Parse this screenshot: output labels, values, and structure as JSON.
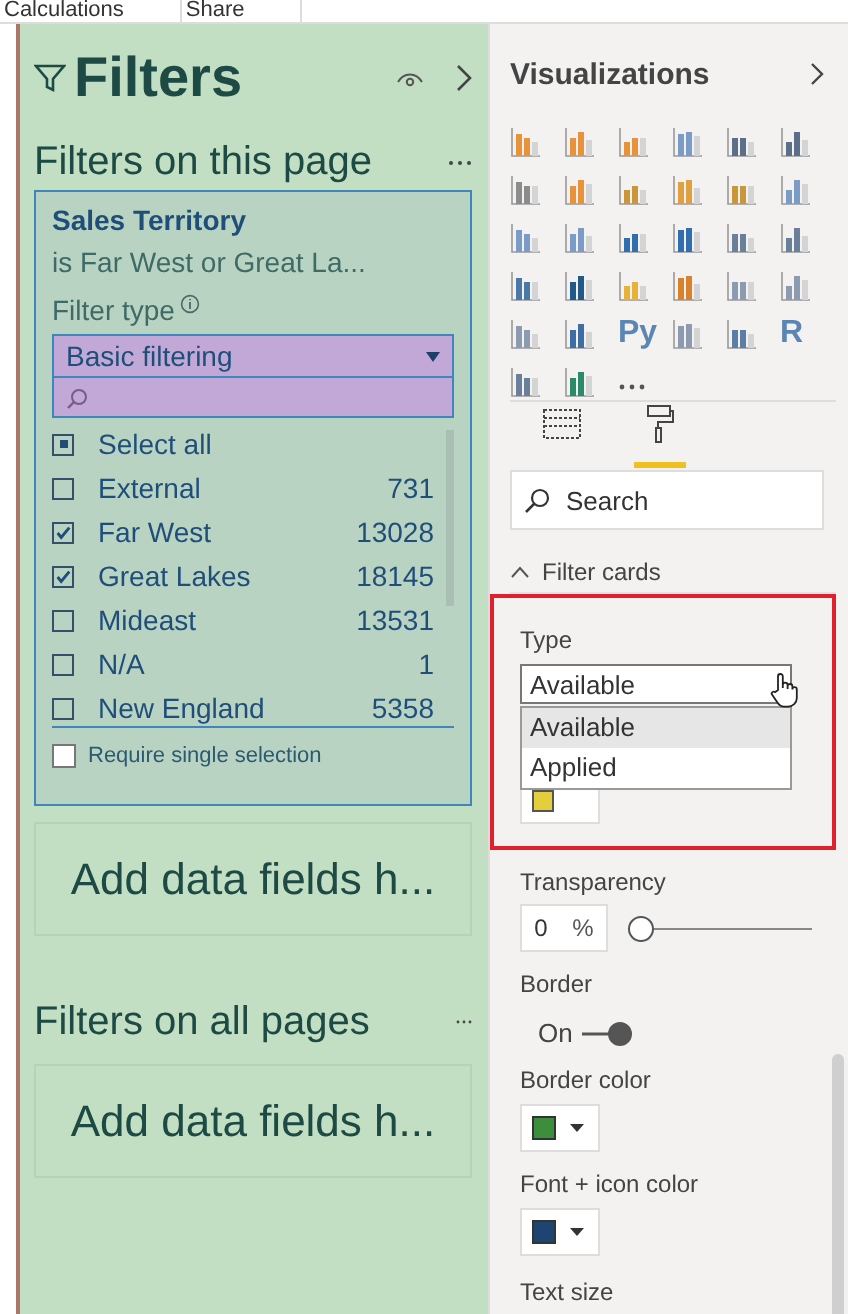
{
  "top_bar": {
    "tabs": [
      "Calculations",
      "Share"
    ]
  },
  "filters_pane": {
    "title": "Filters",
    "section_page": "Filters on this page",
    "card": {
      "title": "Sales Territory",
      "summary": "is Far West or Great La...",
      "filter_type_label": "Filter type",
      "filter_type_value": "Basic filtering",
      "items": [
        {
          "label": "Select all",
          "checked": false,
          "partial": true
        },
        {
          "label": "External",
          "count": "731",
          "checked": false,
          "partial": false
        },
        {
          "label": "Far West",
          "count": "13028",
          "checked": true,
          "partial": false
        },
        {
          "label": "Great Lakes",
          "count": "18145",
          "checked": true,
          "partial": false
        },
        {
          "label": "Mideast",
          "count": "13531",
          "checked": false,
          "partial": false
        },
        {
          "label": "N/A",
          "count": "1",
          "checked": false,
          "partial": false
        },
        {
          "label": "New England",
          "count": "5358",
          "checked": false,
          "partial": false
        }
      ],
      "require_single": {
        "label": "Require single selection",
        "checked": false
      }
    },
    "add_page": "Add data fields h...",
    "section_all": "Filters on all pages",
    "add_all": "Add data fields h..."
  },
  "viz_pane": {
    "title": "Visualizations",
    "icons": [
      {
        "kind": "icon",
        "color": "#e8923a"
      },
      {
        "kind": "icon",
        "color": "#e8923a"
      },
      {
        "kind": "icon",
        "color": "#e8923a"
      },
      {
        "kind": "icon",
        "color": "#7a9cc6"
      },
      {
        "kind": "icon",
        "color": "#5b6e8a"
      },
      {
        "kind": "icon",
        "color": "#5b6e8a"
      },
      {
        "kind": "icon",
        "color": "#8c8c8c"
      },
      {
        "kind": "icon",
        "color": "#e8923a"
      },
      {
        "kind": "icon",
        "color": "#c9963a"
      },
      {
        "kind": "icon",
        "color": "#e0a040"
      },
      {
        "kind": "icon",
        "color": "#c9963a"
      },
      {
        "kind": "icon",
        "color": "#7a9cc6"
      },
      {
        "kind": "icon",
        "color": "#7a9cc6"
      },
      {
        "kind": "icon",
        "color": "#7a9cc6"
      },
      {
        "kind": "icon",
        "color": "#2f6fb0"
      },
      {
        "kind": "icon",
        "color": "#2f6fb0"
      },
      {
        "kind": "icon",
        "color": "#6a7f99"
      },
      {
        "kind": "icon",
        "color": "#6a7f99"
      },
      {
        "kind": "icon",
        "color": "#4a78a8"
      },
      {
        "kind": "icon",
        "color": "#1f5a8a"
      },
      {
        "kind": "icon",
        "color": "#e8b23a"
      },
      {
        "kind": "icon",
        "color": "#d9822b"
      },
      {
        "kind": "icon",
        "color": "#8c9bb0"
      },
      {
        "kind": "icon",
        "color": "#8c9bb0"
      },
      {
        "kind": "icon",
        "color": "#8c9bb0"
      },
      {
        "kind": "icon",
        "color": "#3d6fa5"
      },
      {
        "kind": "text",
        "text": "Py"
      },
      {
        "kind": "icon",
        "color": "#8c9bb0"
      },
      {
        "kind": "icon",
        "color": "#5b7ea6"
      },
      {
        "kind": "text",
        "text": "R"
      },
      {
        "kind": "icon",
        "color": "#6a7f99"
      },
      {
        "kind": "icon",
        "color": "#2a8a6a"
      },
      {
        "kind": "more"
      }
    ],
    "tabs": [
      {
        "kind": "fields",
        "selected": false
      },
      {
        "kind": "format",
        "selected": true
      }
    ],
    "search": {
      "placeholder": "Search"
    },
    "section": {
      "title": "Filter cards",
      "expanded": true
    },
    "type": {
      "label": "Type",
      "value": "Available",
      "options": [
        {
          "label": "Available",
          "selected": true
        },
        {
          "label": "Applied",
          "selected": false
        }
      ],
      "covered_swatch": {
        "color": "#e3cf3c"
      }
    },
    "transparency": {
      "label": "Transparency",
      "value": "0",
      "unit": "%",
      "level": 0
    },
    "border": {
      "label": "Border",
      "toggle_label": "On",
      "on": true
    },
    "color_settings": [
      {
        "label": "Border color",
        "color": "#3c8d3c"
      },
      {
        "label": "Font + icon color",
        "color": "#1e4472"
      }
    ],
    "cut_label": "Text size"
  }
}
